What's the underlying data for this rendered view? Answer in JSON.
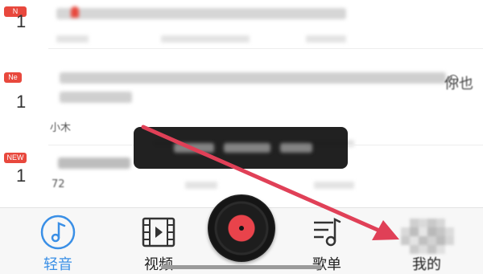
{
  "feed": {
    "items": [
      {
        "badge": "N",
        "rank": "1"
      },
      {
        "badge": "Ne",
        "rank": "1",
        "tail_text": "你也",
        "author": "小木"
      },
      {
        "badge": "NEW",
        "rank": "1",
        "author": "72"
      }
    ]
  },
  "tabbar": {
    "tabs": [
      {
        "label": "轻音",
        "icon": "music-note-icon",
        "active": true
      },
      {
        "label": "视频",
        "icon": "video-film-icon",
        "active": false
      },
      {
        "label": "",
        "icon": "vinyl-disc-icon",
        "active": false
      },
      {
        "label": "歌单",
        "icon": "playlist-icon",
        "active": false
      },
      {
        "label": "我的",
        "icon": "user-heart-icon",
        "active": false
      }
    ]
  },
  "colors": {
    "accent": "#3a8fe6",
    "badge": "#e8483d",
    "annotation_arrow": "#e04057",
    "disc_center": "#e9434b"
  }
}
